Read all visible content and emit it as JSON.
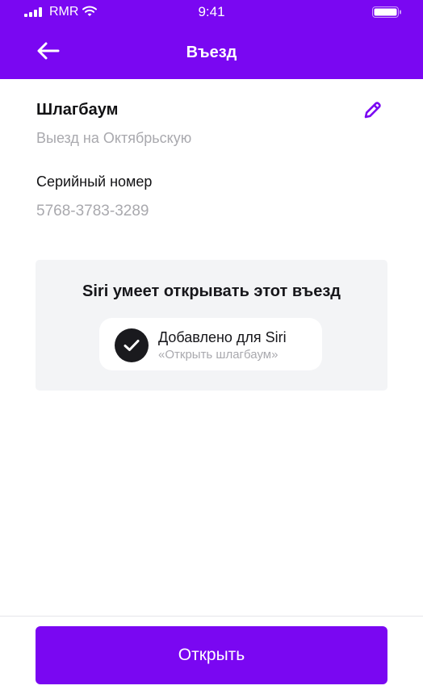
{
  "status_bar": {
    "carrier": "RMR",
    "time": "9:41",
    "signal_icon": "cellular-signal-icon",
    "wifi_icon": "wifi-icon",
    "battery_icon": "battery-icon"
  },
  "nav": {
    "title": "Въезд",
    "back_icon": "arrow-left-icon"
  },
  "barrier": {
    "title": "Шлагбаум",
    "subtitle": "Выезд на Октябрьскую",
    "edit_icon": "pencil-icon"
  },
  "serial": {
    "label": "Серийный номер",
    "value": "5768-3783-3289"
  },
  "siri": {
    "title": "Siri умеет открывать этот въезд",
    "added_label": "Добавлено для Siri",
    "phrase": "«Открыть шлагбаум»",
    "check_icon": "checkmark-icon"
  },
  "actions": {
    "open_label": "Открыть"
  },
  "colors": {
    "accent": "#7a07f2",
    "card_background": "#f3f4f6",
    "muted_text": "#a9a9ae"
  }
}
